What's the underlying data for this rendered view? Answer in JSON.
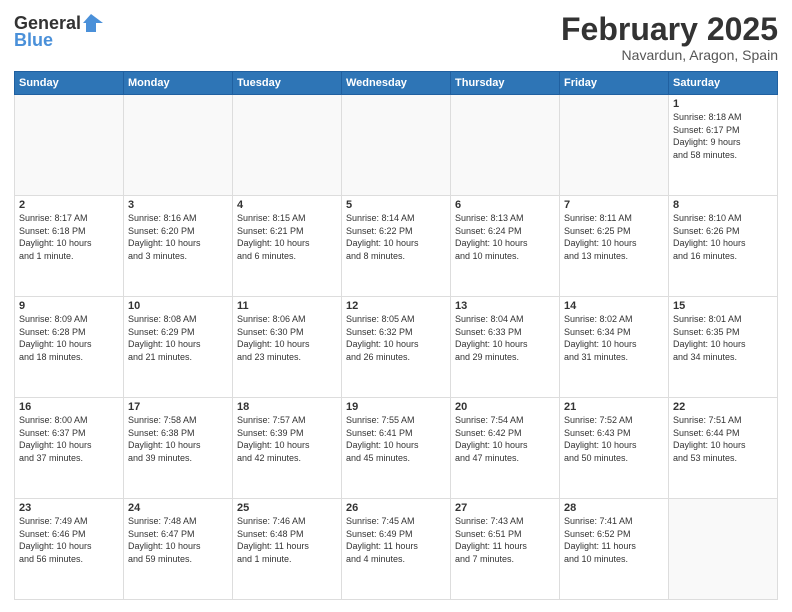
{
  "logo": {
    "line1": "General",
    "line2": "Blue"
  },
  "header": {
    "month": "February 2025",
    "location": "Navardun, Aragon, Spain"
  },
  "weekdays": [
    "Sunday",
    "Monday",
    "Tuesday",
    "Wednesday",
    "Thursday",
    "Friday",
    "Saturday"
  ],
  "weeks": [
    [
      {
        "day": "",
        "info": ""
      },
      {
        "day": "",
        "info": ""
      },
      {
        "day": "",
        "info": ""
      },
      {
        "day": "",
        "info": ""
      },
      {
        "day": "",
        "info": ""
      },
      {
        "day": "",
        "info": ""
      },
      {
        "day": "1",
        "info": "Sunrise: 8:18 AM\nSunset: 6:17 PM\nDaylight: 9 hours\nand 58 minutes."
      }
    ],
    [
      {
        "day": "2",
        "info": "Sunrise: 8:17 AM\nSunset: 6:18 PM\nDaylight: 10 hours\nand 1 minute."
      },
      {
        "day": "3",
        "info": "Sunrise: 8:16 AM\nSunset: 6:20 PM\nDaylight: 10 hours\nand 3 minutes."
      },
      {
        "day": "4",
        "info": "Sunrise: 8:15 AM\nSunset: 6:21 PM\nDaylight: 10 hours\nand 6 minutes."
      },
      {
        "day": "5",
        "info": "Sunrise: 8:14 AM\nSunset: 6:22 PM\nDaylight: 10 hours\nand 8 minutes."
      },
      {
        "day": "6",
        "info": "Sunrise: 8:13 AM\nSunset: 6:24 PM\nDaylight: 10 hours\nand 10 minutes."
      },
      {
        "day": "7",
        "info": "Sunrise: 8:11 AM\nSunset: 6:25 PM\nDaylight: 10 hours\nand 13 minutes."
      },
      {
        "day": "8",
        "info": "Sunrise: 8:10 AM\nSunset: 6:26 PM\nDaylight: 10 hours\nand 16 minutes."
      }
    ],
    [
      {
        "day": "9",
        "info": "Sunrise: 8:09 AM\nSunset: 6:28 PM\nDaylight: 10 hours\nand 18 minutes."
      },
      {
        "day": "10",
        "info": "Sunrise: 8:08 AM\nSunset: 6:29 PM\nDaylight: 10 hours\nand 21 minutes."
      },
      {
        "day": "11",
        "info": "Sunrise: 8:06 AM\nSunset: 6:30 PM\nDaylight: 10 hours\nand 23 minutes."
      },
      {
        "day": "12",
        "info": "Sunrise: 8:05 AM\nSunset: 6:32 PM\nDaylight: 10 hours\nand 26 minutes."
      },
      {
        "day": "13",
        "info": "Sunrise: 8:04 AM\nSunset: 6:33 PM\nDaylight: 10 hours\nand 29 minutes."
      },
      {
        "day": "14",
        "info": "Sunrise: 8:02 AM\nSunset: 6:34 PM\nDaylight: 10 hours\nand 31 minutes."
      },
      {
        "day": "15",
        "info": "Sunrise: 8:01 AM\nSunset: 6:35 PM\nDaylight: 10 hours\nand 34 minutes."
      }
    ],
    [
      {
        "day": "16",
        "info": "Sunrise: 8:00 AM\nSunset: 6:37 PM\nDaylight: 10 hours\nand 37 minutes."
      },
      {
        "day": "17",
        "info": "Sunrise: 7:58 AM\nSunset: 6:38 PM\nDaylight: 10 hours\nand 39 minutes."
      },
      {
        "day": "18",
        "info": "Sunrise: 7:57 AM\nSunset: 6:39 PM\nDaylight: 10 hours\nand 42 minutes."
      },
      {
        "day": "19",
        "info": "Sunrise: 7:55 AM\nSunset: 6:41 PM\nDaylight: 10 hours\nand 45 minutes."
      },
      {
        "day": "20",
        "info": "Sunrise: 7:54 AM\nSunset: 6:42 PM\nDaylight: 10 hours\nand 47 minutes."
      },
      {
        "day": "21",
        "info": "Sunrise: 7:52 AM\nSunset: 6:43 PM\nDaylight: 10 hours\nand 50 minutes."
      },
      {
        "day": "22",
        "info": "Sunrise: 7:51 AM\nSunset: 6:44 PM\nDaylight: 10 hours\nand 53 minutes."
      }
    ],
    [
      {
        "day": "23",
        "info": "Sunrise: 7:49 AM\nSunset: 6:46 PM\nDaylight: 10 hours\nand 56 minutes."
      },
      {
        "day": "24",
        "info": "Sunrise: 7:48 AM\nSunset: 6:47 PM\nDaylight: 10 hours\nand 59 minutes."
      },
      {
        "day": "25",
        "info": "Sunrise: 7:46 AM\nSunset: 6:48 PM\nDaylight: 11 hours\nand 1 minute."
      },
      {
        "day": "26",
        "info": "Sunrise: 7:45 AM\nSunset: 6:49 PM\nDaylight: 11 hours\nand 4 minutes."
      },
      {
        "day": "27",
        "info": "Sunrise: 7:43 AM\nSunset: 6:51 PM\nDaylight: 11 hours\nand 7 minutes."
      },
      {
        "day": "28",
        "info": "Sunrise: 7:41 AM\nSunset: 6:52 PM\nDaylight: 11 hours\nand 10 minutes."
      },
      {
        "day": "",
        "info": ""
      }
    ]
  ]
}
